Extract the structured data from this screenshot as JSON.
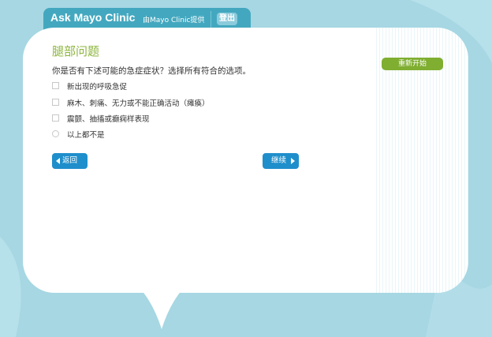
{
  "header": {
    "app_title": "Ask Mayo Clinic",
    "provider": "由Mayo Clinic提供",
    "logout_label": "登出"
  },
  "sidebar": {
    "restart_label": "重新开始"
  },
  "question": {
    "title": "腿部问题",
    "prompt": "你是否有下述可能的急症症状？选择所有符合的选项。",
    "options": [
      {
        "label": "新出现的呼吸急促",
        "type": "checkbox",
        "checked": false
      },
      {
        "label": "麻木、刺痛、无力或不能正确活动（瘫痪）",
        "type": "checkbox",
        "checked": false
      },
      {
        "label": "震颤、抽搐或癫痫样表现",
        "type": "checkbox",
        "checked": false
      },
      {
        "label": "以上都不是",
        "type": "radio",
        "checked": false
      }
    ]
  },
  "nav": {
    "back_label": "返回",
    "next_label": "继续"
  },
  "colors": {
    "background": "#a6d7e3",
    "header": "#43a8bf",
    "title_green": "#8cb53c",
    "restart_green": "#7fae31",
    "nav_blue": "#1f8fcb"
  },
  "icons": {
    "back": "caret-left-icon",
    "next": "caret-right-icon"
  }
}
